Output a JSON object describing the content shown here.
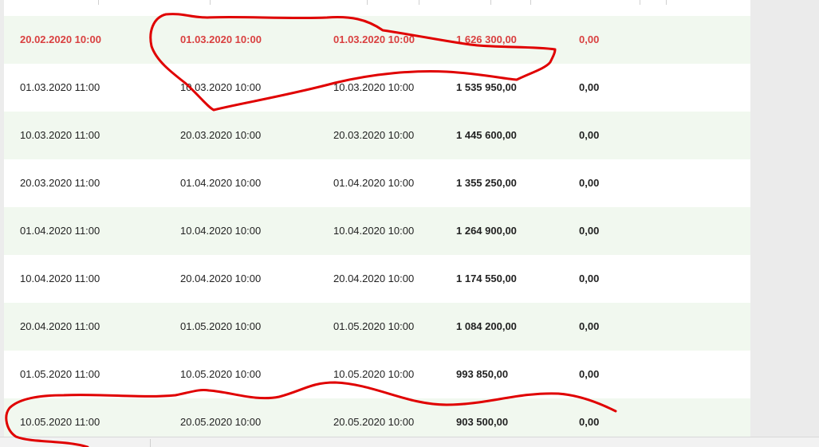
{
  "table": {
    "rows": [
      {
        "start": "20.02.2020 10:00",
        "end": "01.03.2020 10:00",
        "date": "01.03.2020 10:00",
        "amount": "1 626 300,00",
        "extra": "0,00",
        "highlight": true
      },
      {
        "start": "01.03.2020 11:00",
        "end": "10.03.2020 10:00",
        "date": "10.03.2020 10:00",
        "amount": "1 535 950,00",
        "extra": "0,00",
        "highlight": false
      },
      {
        "start": "10.03.2020 11:00",
        "end": "20.03.2020 10:00",
        "date": "20.03.2020 10:00",
        "amount": "1 445 600,00",
        "extra": "0,00",
        "highlight": false
      },
      {
        "start": "20.03.2020 11:00",
        "end": "01.04.2020 10:00",
        "date": "01.04.2020 10:00",
        "amount": "1 355 250,00",
        "extra": "0,00",
        "highlight": false
      },
      {
        "start": "01.04.2020 11:00",
        "end": "10.04.2020 10:00",
        "date": "10.04.2020 10:00",
        "amount": "1 264 900,00",
        "extra": "0,00",
        "highlight": false
      },
      {
        "start": "10.04.2020 11:00",
        "end": "20.04.2020 10:00",
        "date": "20.04.2020 10:00",
        "amount": "1 174 550,00",
        "extra": "0,00",
        "highlight": false
      },
      {
        "start": "20.04.2020 11:00",
        "end": "01.05.2020 10:00",
        "date": "01.05.2020 10:00",
        "amount": "1 084 200,00",
        "extra": "0,00",
        "highlight": false
      },
      {
        "start": "01.05.2020 11:00",
        "end": "10.05.2020 10:00",
        "date": "10.05.2020 10:00",
        "amount": "993 850,00",
        "extra": "0,00",
        "highlight": false
      },
      {
        "start": "10.05.2020 11:00",
        "end": "20.05.2020 10:00",
        "date": "20.05.2020 10:00",
        "amount": "903 500,00",
        "extra": "0,00",
        "highlight": false
      }
    ]
  },
  "colors": {
    "row_alt": "#f1f8ef",
    "highlight_text": "#d94040",
    "annotation_ink": "#e00000"
  }
}
